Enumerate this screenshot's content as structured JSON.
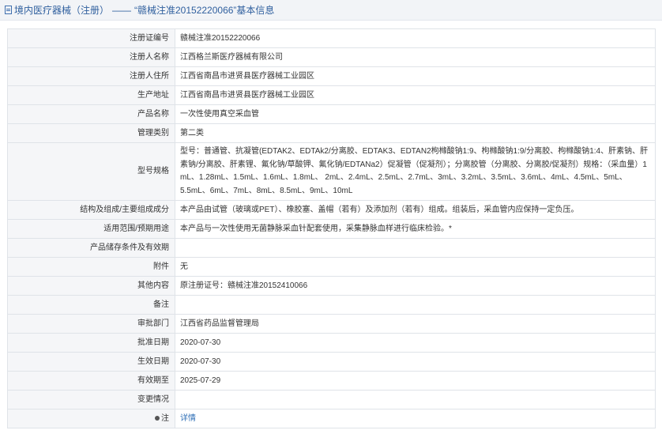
{
  "header": {
    "breadcrumb_home": "境内医疗器械（注册）",
    "separator": "——",
    "title": "“赣械注准20152220066”基本信息"
  },
  "rows": [
    {
      "label": "注册证编号",
      "value": "赣械注准20152220066"
    },
    {
      "label": "注册人名称",
      "value": "江西格兰斯医疗器械有限公司"
    },
    {
      "label": "注册人住所",
      "value": "江西省南昌市进贤县医疗器械工业园区"
    },
    {
      "label": "生产地址",
      "value": "江西省南昌市进贤县医疗器械工业园区"
    },
    {
      "label": "产品名称",
      "value": "一次性使用真空采血管"
    },
    {
      "label": "管理类别",
      "value": "第二类"
    },
    {
      "label": "型号规格",
      "value": "型号：普通管、抗凝管(EDTAK2、EDTAk2/分离胶、EDTAK3、EDTAN2枸橼酸钠1:9、枸橼酸钠1:9/分离胶、枸橼酸钠1:4、肝素钠、肝素钠/分离胶、肝素锂、氟化钠/草酸钾、氟化钠/EDTANa2）促凝管（促凝剂）；分离胶管（分离胶、分离胶/促凝剂）规格：（采血量）1 mL、1.28mL、1.5mL、1.6mL、1.8mL、 2mL、2.4mL、2.5mL、2.7mL、3mL、3.2mL、3.5mL、3.6mL、4mL、4.5mL、5mL、5.5mL、6mL、7mL、8mL、8.5mL、9mL、10mL"
    },
    {
      "label": "结构及组成/主要组成成分",
      "value": "本产品由试管（玻璃或PET）、橡胶塞、盖帽（若有）及添加剂（若有）组成。组装后，采血管内应保持一定负压。"
    },
    {
      "label": "适用范围/预期用途",
      "value": "本产品与一次性使用无菌静脉采血针配套使用，采集静脉血样进行临床检验。*"
    },
    {
      "label": "产品储存条件及有效期",
      "value": ""
    },
    {
      "label": "附件",
      "value": "无"
    },
    {
      "label": "其他内容",
      "value": "原注册证号：赣械注准20152410066"
    },
    {
      "label": "备注",
      "value": ""
    },
    {
      "label": "审批部门",
      "value": "江西省药品监督管理局"
    },
    {
      "label": "批准日期",
      "value": "2020-07-30"
    },
    {
      "label": "生效日期",
      "value": "2020-07-30"
    },
    {
      "label": "有效期至",
      "value": "2025-07-29"
    },
    {
      "label": "变更情况",
      "value": ""
    },
    {
      "label": "注",
      "value": "详情"
    }
  ]
}
